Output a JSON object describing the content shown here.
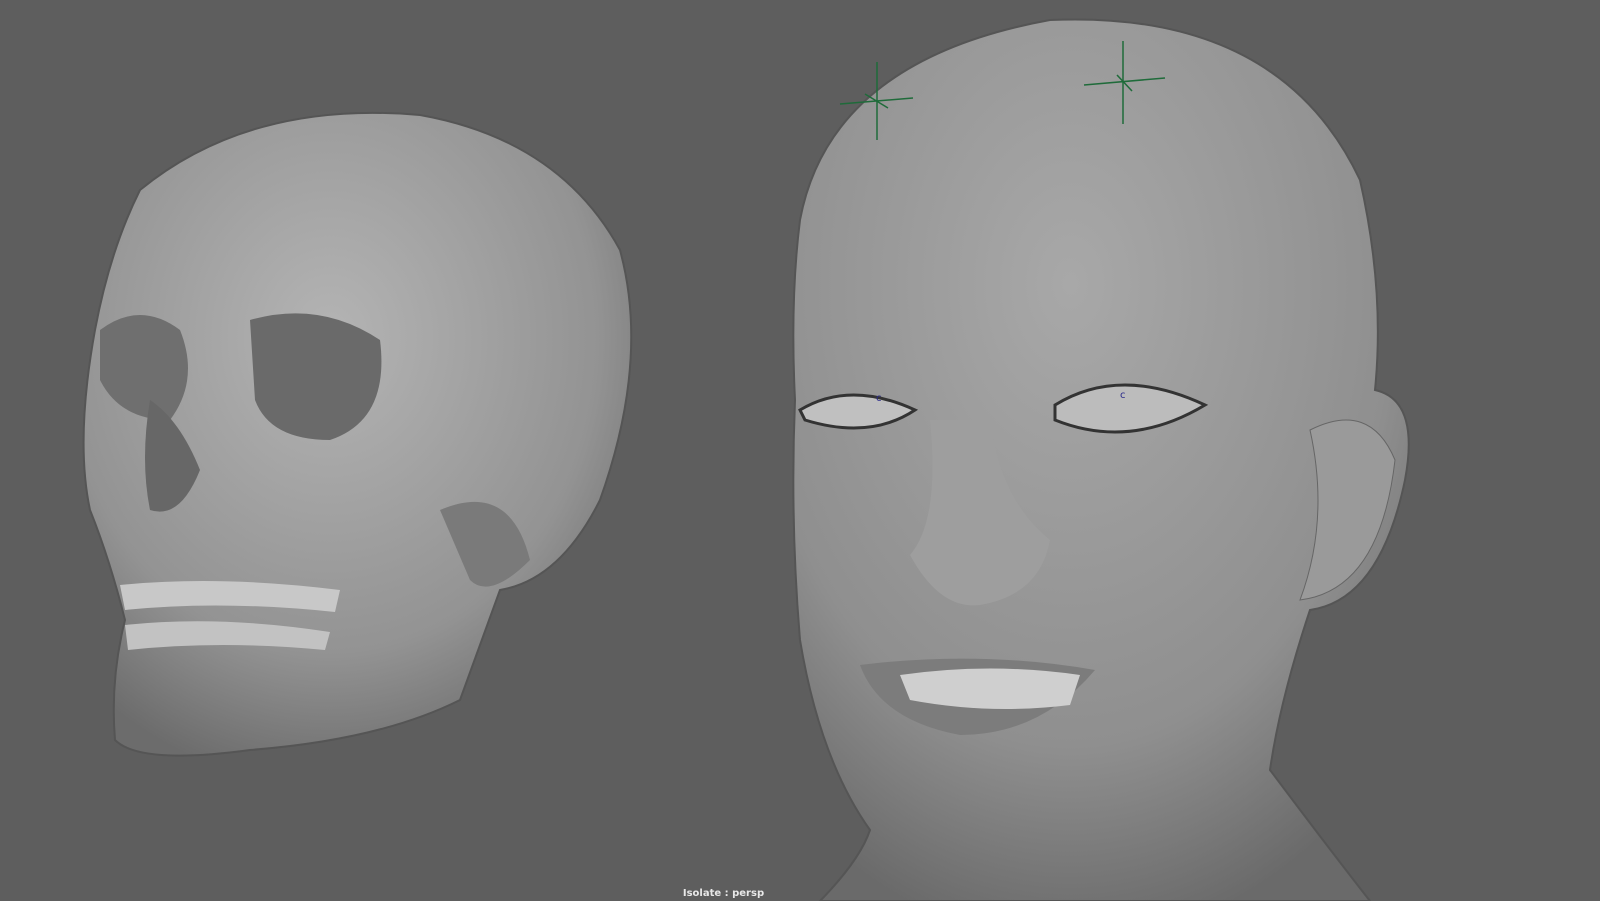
{
  "viewport": {
    "camera": "persp",
    "hud_label": "Isolate : persp",
    "background_color": "#5e5e5e",
    "locator_color": "#1f6b3a",
    "objects": [
      "skull-mesh",
      "head-mesh",
      "forehead-locator-left",
      "forehead-locator-right"
    ],
    "eye_markers": [
      "c",
      "c"
    ]
  }
}
